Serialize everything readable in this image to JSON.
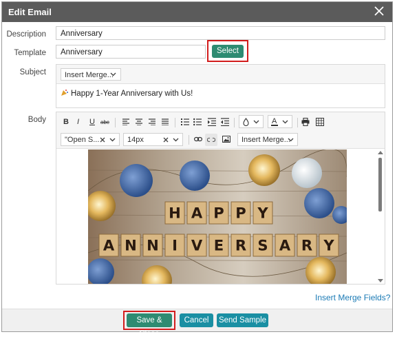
{
  "dialog": {
    "title": "Edit Email"
  },
  "fields": {
    "description_label": "Description",
    "description_value": "Anniversary",
    "template_label": "Template",
    "template_value": "Anniversary",
    "select_button": "Select",
    "subject_label": "Subject",
    "subject_merge_label": "Insert Merge...",
    "subject_text": "Happy 1-Year Anniversary with Us!",
    "body_label": "Body"
  },
  "editor_toolbar": {
    "bold": "B",
    "italic": "I",
    "underline": "U",
    "strike": "abc",
    "font_family": "\"Open S...",
    "font_size": "14px",
    "insert_merge": "Insert Merge..."
  },
  "image": {
    "word1": [
      "H",
      "A",
      "P",
      "P",
      "Y"
    ],
    "word2": [
      "A",
      "N",
      "N",
      "I",
      "V",
      "E",
      "R",
      "S",
      "A",
      "R",
      "Y"
    ]
  },
  "links": {
    "insert_merge_fields": "Insert Merge Fields?"
  },
  "footer": {
    "save_close": "Save & Close",
    "cancel": "Cancel",
    "send_sample": "Send Sample"
  },
  "colors": {
    "title_bar": "#5b5b5b",
    "green_button": "#2e8b72",
    "teal_button": "#1a8fa3",
    "highlight": "#d21c1c"
  }
}
